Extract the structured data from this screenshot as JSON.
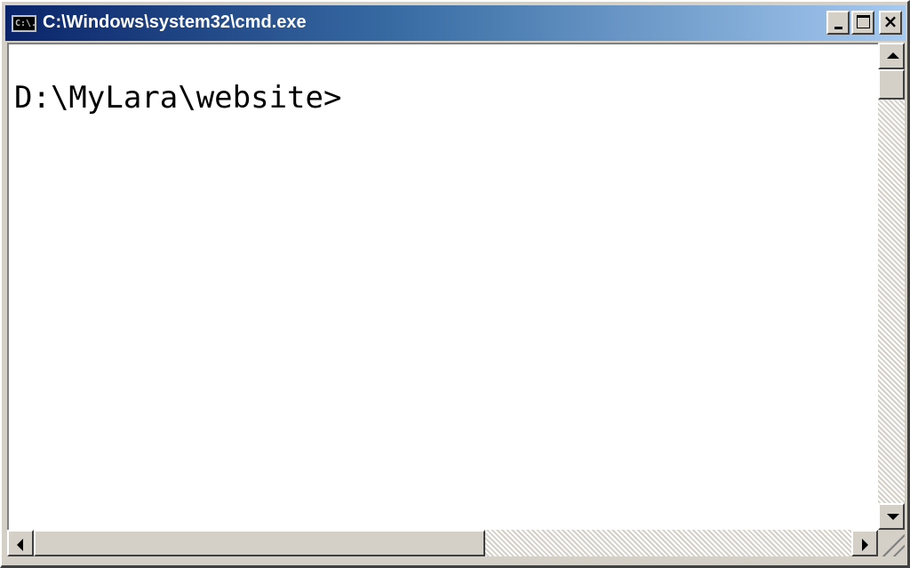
{
  "window": {
    "title": "C:\\Windows\\system32\\cmd.exe",
    "icon": "cmd-icon",
    "icon_text": "C:\\."
  },
  "console": {
    "lines": [
      "D:\\MyLara\\website>"
    ]
  },
  "controls": {
    "minimize_icon": "minimize-icon",
    "maximize_icon": "maximize-icon",
    "close_icon": "close-icon",
    "close_label": "×"
  },
  "scrollbars": {
    "vertical_position": 0.0,
    "horizontal_position": 0.0
  },
  "colors": {
    "titlebar_start": "#0a246a",
    "titlebar_end": "#a6caf0",
    "console_background": "#ffffff",
    "console_text": "#000000"
  }
}
